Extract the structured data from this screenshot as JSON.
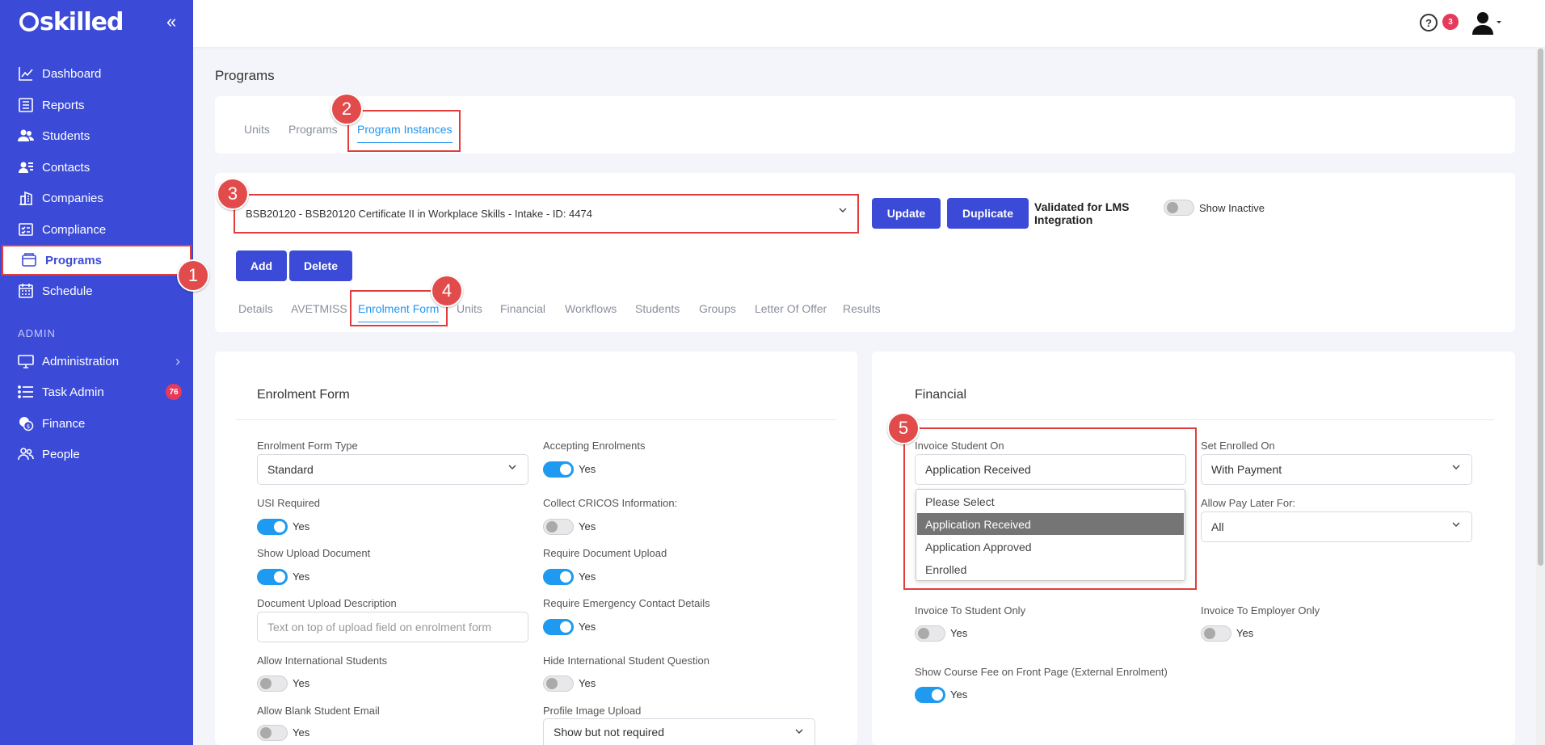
{
  "sidebar": {
    "logo": "skilled",
    "items": [
      {
        "label": "Dashboard",
        "icon": "chart-line-icon"
      },
      {
        "label": "Reports",
        "icon": "report-icon"
      },
      {
        "label": "Students",
        "icon": "users-icon"
      },
      {
        "label": "Contacts",
        "icon": "contacts-icon"
      },
      {
        "label": "Companies",
        "icon": "building-icon"
      },
      {
        "label": "Compliance",
        "icon": "checklist-icon"
      },
      {
        "label": "Programs",
        "icon": "folder-icon"
      },
      {
        "label": "Schedule",
        "icon": "calendar-icon"
      }
    ],
    "admin_section": "ADMIN",
    "admin_items": [
      {
        "label": "Administration",
        "icon": "monitor-icon"
      },
      {
        "label": "Task Admin",
        "icon": "list-icon",
        "badge": "76"
      },
      {
        "label": "Finance",
        "icon": "coins-icon"
      },
      {
        "label": "People",
        "icon": "people-icon"
      }
    ]
  },
  "topbar": {
    "help": "?",
    "notifications": "3"
  },
  "page_title": "Programs",
  "program_tabs": [
    "Units",
    "Programs",
    "Program Instances"
  ],
  "instance": {
    "selected": "BSB20120 - BSB20120 Certificate II in Workplace Skills - Intake - ID: 4474",
    "update_label": "Update",
    "duplicate_label": "Duplicate",
    "validated_label": "Validated for LMS Integration",
    "show_inactive_label": "Show Inactive",
    "add_label": "Add",
    "delete_label": "Delete"
  },
  "detail_tabs": [
    "Details",
    "AVETMISS",
    "Enrolment Form",
    "Units",
    "Financial",
    "Workflows",
    "Students",
    "Groups",
    "Letter Of Offer",
    "Results"
  ],
  "steps": [
    "1",
    "2",
    "3",
    "4",
    "5"
  ],
  "enrolment_form": {
    "title": "Enrolment Form",
    "form_type_label": "Enrolment Form Type",
    "form_type_value": "Standard",
    "accepting_label": "Accepting Enrolments",
    "usi_label": "USI Required",
    "cricos_label": "Collect CRICOS Information:",
    "show_upload_label": "Show Upload Document",
    "require_upload_label": "Require Document Upload",
    "doc_desc_label": "Document Upload Description",
    "doc_desc_placeholder": "Text on top of upload field on enrolment form",
    "emergency_label": "Require Emergency Contact Details",
    "international_label": "Allow International Students",
    "hide_international_label": "Hide International Student Question",
    "blank_email_label": "Allow Blank Student Email",
    "profile_image_label": "Profile Image Upload",
    "profile_image_value": "Show but not required",
    "yes": "Yes"
  },
  "financial": {
    "title": "Financial",
    "invoice_on_label": "Invoice Student On",
    "invoice_on_value": "Application Received",
    "invoice_options": [
      "Please Select",
      "Application Received",
      "Application Approved",
      "Enrolled"
    ],
    "enrolled_on_label": "Set Enrolled On",
    "enrolled_on_value": "With Payment",
    "pay_later_label": "Allow Pay Later For:",
    "pay_later_value": "All",
    "student_only_label": "Invoice To Student Only",
    "employer_only_label": "Invoice To Employer Only",
    "course_fee_label": "Show Course Fee on Front Page (External Enrolment)",
    "yes": "Yes"
  },
  "colors": {
    "sidebar": "#3b4bd8",
    "accent": "#1e9bf0",
    "highlight": "#e23c3c"
  }
}
